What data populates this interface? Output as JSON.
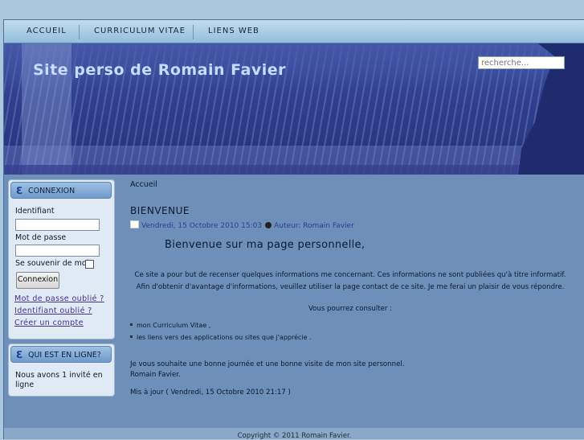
{
  "nav": {
    "items": [
      "ACCUEIL",
      "CURRICULUM VITAE",
      "LIENS WEB"
    ]
  },
  "header": {
    "site_title": "Site perso de Romain Favier",
    "search_placeholder": "recherche..."
  },
  "login_module": {
    "title": "CONNEXION",
    "username_label": "Identifiant",
    "password_label": "Mot de passe",
    "remember_label": "Se souvenir de moi",
    "submit_label": "Connexion",
    "links": [
      "Mot de passe oublié ?",
      "Identifiant oublié ?",
      "Créer un compte"
    ]
  },
  "online_module": {
    "title": "QUI EST EN LIGNE?",
    "text": "Nous avons 1 invité en ligne"
  },
  "content": {
    "breadcrumb": "Accueil",
    "article_title": "BIENVENUE",
    "date": "Vendredi, 15 Octobre 2010 15:03",
    "author": "Auteur: Romain Favier",
    "welcome": "Bienvenue sur ma page personnelle,",
    "intro": "Ce site a pour but de recenser quelques informations me concernant. Ces informations ne sont publiées qu'à titre informatif. Afin d'obtenir d'avantage d'informations, veuillez utiliser la page contact de ce site. Je me ferai un plaisir de vous répondre.",
    "consult": "Vous pourrez consulter :",
    "bullets": [
      "mon Curriculum Vitae ,",
      "les liens vers des applications ou sites que j'apprécie ."
    ],
    "closing_line1": "Je vous souhaite une bonne journée et une bonne visite de mon site personnel.",
    "closing_line2": "Romain Favier.",
    "updated": "Mis à jour ( Vendredi, 15 Octobre 2010 21:17 )"
  },
  "footer": {
    "copyright": "Copyright © 2011 Romain Favier."
  }
}
